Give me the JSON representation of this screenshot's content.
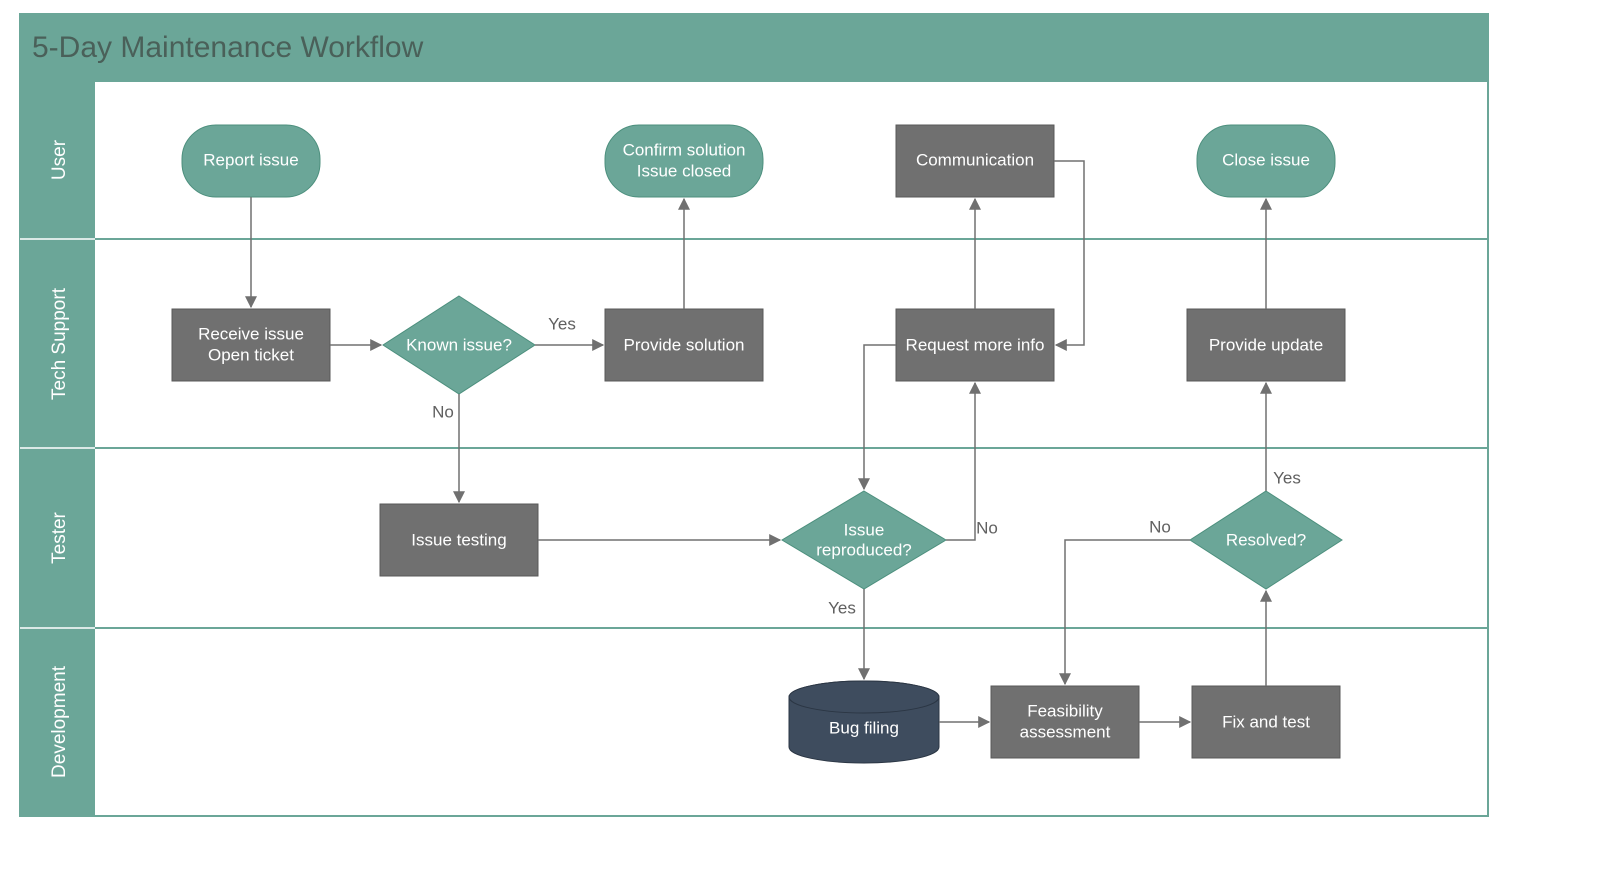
{
  "title": "5-Day Maintenance Workflow",
  "lanes": {
    "user": "User",
    "tech": "Tech Support",
    "tester": "Tester",
    "dev": "Development"
  },
  "nodes": {
    "report_issue": "Report issue",
    "confirm_solution_l1": "Confirm solution",
    "confirm_solution_l2": "Issue closed",
    "communication": "Communication",
    "close_issue": "Close issue",
    "receive_l1": "Receive issue",
    "receive_l2": "Open ticket",
    "known_issue": "Known issue?",
    "provide_solution": "Provide solution",
    "request_more_info": "Request more info",
    "provide_update": "Provide update",
    "issue_testing": "Issue testing",
    "issue_reproduced_l1": "Issue",
    "issue_reproduced_l2": "reproduced?",
    "resolved": "Resolved?",
    "bug_filing": "Bug filing",
    "feasibility_l1": "Feasibility",
    "feasibility_l2": "assessment",
    "fix_and_test": "Fix and test"
  },
  "labels": {
    "yes1": "Yes",
    "no1": "No",
    "no2": "No",
    "yes2": "Yes",
    "no3": "No",
    "yes3": "Yes"
  },
  "colors": {
    "teal": "#6ba698",
    "teal_border": "#4c8f7d",
    "header_teal": "#6ba698",
    "dark_gray": "#707070",
    "navy": "#3e4c5e",
    "lane_line": "#6ba698",
    "outer_border": "#6ba698"
  }
}
